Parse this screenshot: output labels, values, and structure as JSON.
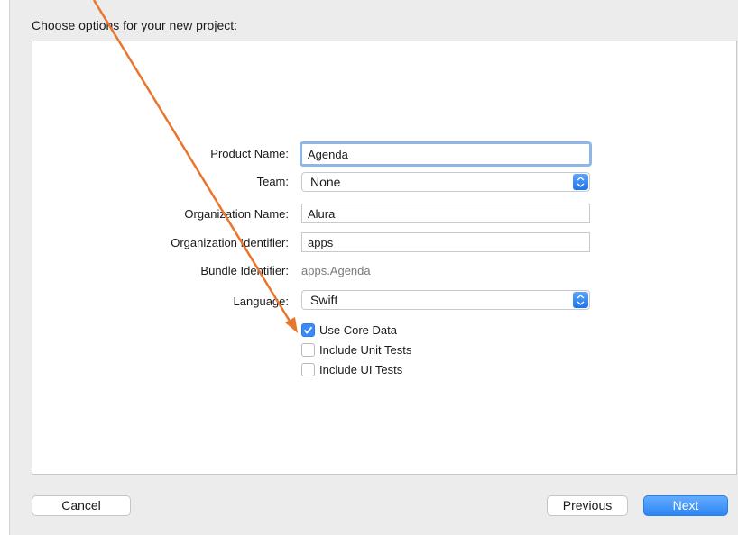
{
  "dialog": {
    "heading": "Choose options for your new project:"
  },
  "form": {
    "product_name_label": "Product Name:",
    "product_name_value": "Agenda",
    "team_label": "Team:",
    "team_value": "None",
    "org_name_label": "Organization Name:",
    "org_name_value": "Alura",
    "org_id_label": "Organization Identifier:",
    "org_id_value": "apps",
    "bundle_id_label": "Bundle Identifier:",
    "bundle_id_value": "apps.Agenda",
    "language_label": "Language:",
    "language_value": "Swift"
  },
  "options": [
    {
      "label": "Use Core Data",
      "checked": true
    },
    {
      "label": "Include Unit Tests",
      "checked": false
    },
    {
      "label": "Include UI Tests",
      "checked": false
    }
  ],
  "buttons": {
    "cancel": "Cancel",
    "previous": "Previous",
    "next": "Next"
  },
  "colors": {
    "accent": "#2b86f3",
    "annotation_arrow": "#e8762d"
  }
}
